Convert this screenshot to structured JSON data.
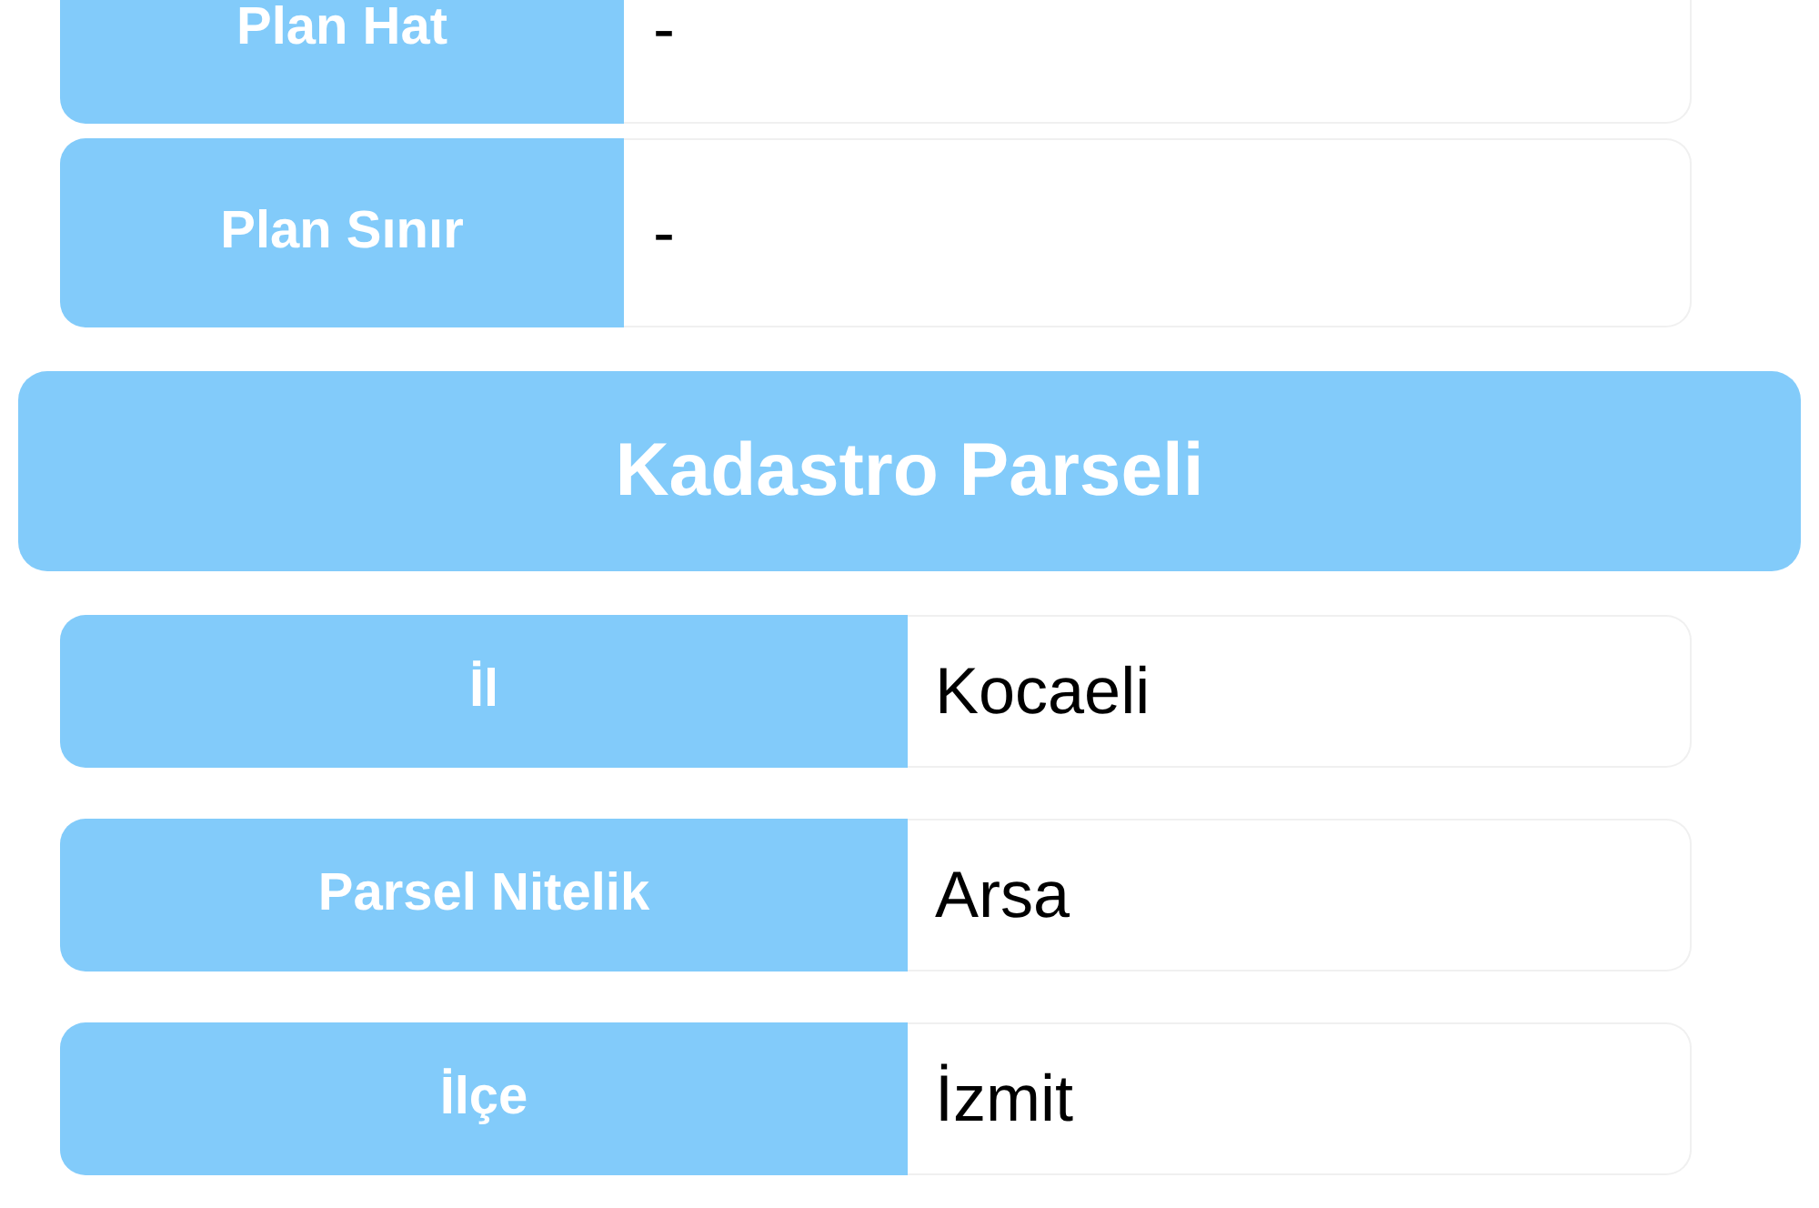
{
  "sections": [
    {
      "rows": [
        {
          "label": "Plan Hat",
          "value": "-"
        },
        {
          "label": "Plan Sınır",
          "value": "-"
        }
      ]
    },
    {
      "title": "Kadastro Parseli",
      "rows": [
        {
          "label": "İl",
          "value": "Kocaeli"
        },
        {
          "label": "Parsel Nitelik",
          "value": "Arsa"
        },
        {
          "label": "İlçe",
          "value": "İzmit"
        }
      ]
    }
  ]
}
